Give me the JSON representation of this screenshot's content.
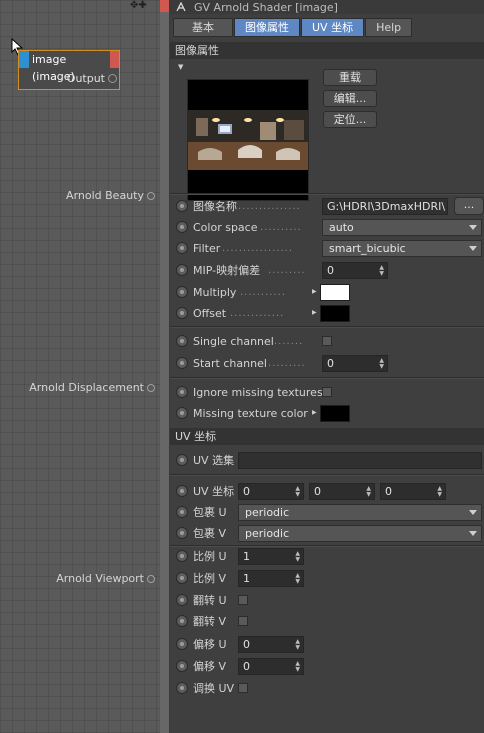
{
  "node_editor": {
    "node": {
      "title": "image (image)",
      "output_label": "Output"
    },
    "ports": [
      "Arnold Beauty",
      "Arnold Displacement",
      "Arnold Viewport"
    ]
  },
  "panel": {
    "window_title": "GV Arnold Shader [image]",
    "tabs": [
      "基本",
      "图像属性",
      "UV 坐标",
      "Help"
    ],
    "section_title": "图像属性",
    "buttons": {
      "reload": "重载",
      "edit": "编辑...",
      "locate": "定位..."
    },
    "image_name": {
      "label": "图像名称",
      "value": "G:\\HDRI\\3DmaxHDRI\\",
      "browse": "..."
    },
    "color_space": {
      "label": "Color space",
      "value": "auto"
    },
    "filter": {
      "label": "Filter",
      "value": "smart_bicubic"
    },
    "mip_bias": {
      "label": "MIP-映射偏差",
      "value": "0"
    },
    "multiply": {
      "label": "Multiply",
      "color": "#ffffff"
    },
    "offset": {
      "label": "Offset",
      "color": "#000000"
    },
    "single_channel": {
      "label": "Single channel"
    },
    "start_channel": {
      "label": "Start channel",
      "value": "0"
    },
    "ignore_missing": {
      "label": "Ignore missing textures"
    },
    "missing_color": {
      "label": "Missing texture color",
      "color": "#000000"
    },
    "uv_section": "UV 坐标",
    "uv_set": {
      "label": "UV 选集",
      "value": ""
    },
    "uv_coords": {
      "label": "UV 坐标",
      "values": [
        "0",
        "0",
        "0"
      ]
    },
    "wrap_u": {
      "label": "包裹 U",
      "value": "periodic"
    },
    "wrap_v": {
      "label": "包裹 V",
      "value": "periodic"
    },
    "scale_u": {
      "label": "比例 U",
      "value": "1"
    },
    "scale_v": {
      "label": "比例 V",
      "value": "1"
    },
    "flip_u": {
      "label": "翻转 U"
    },
    "flip_v": {
      "label": "翻转 V"
    },
    "offset_u": {
      "label": "偏移 U",
      "value": "0"
    },
    "offset_v": {
      "label": "偏移 V",
      "value": "0"
    },
    "swap_uv": {
      "label": "调换 UV"
    }
  }
}
